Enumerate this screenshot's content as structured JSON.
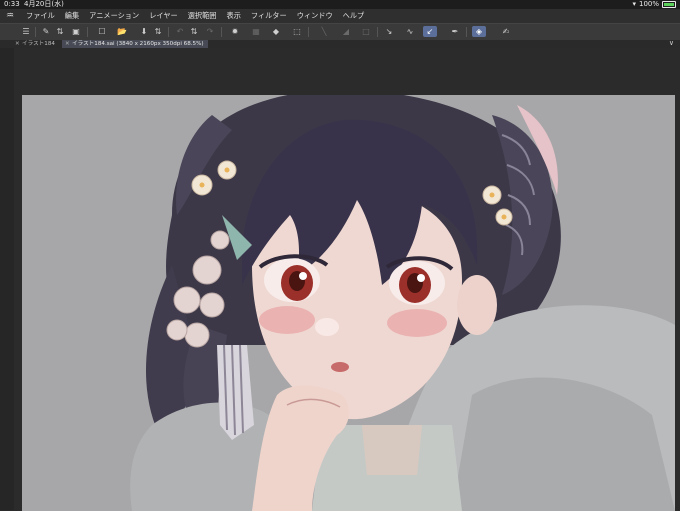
{
  "status": {
    "time": "0:33",
    "date": "4月20日(水)",
    "battery": "100%"
  },
  "menu": {
    "app_icon": "clip-studio-icon",
    "items": [
      "ファイル",
      "編集",
      "アニメーション",
      "レイヤー",
      "選択範囲",
      "表示",
      "フィルター",
      "ウィンドウ",
      "ヘルプ"
    ]
  },
  "toolbar": {
    "icons": [
      "menu-icon",
      "new-icon",
      "stepper-icon",
      "gallery-icon",
      "new-canvas-icon",
      "open-icon",
      "save-icon",
      "stepper-icon",
      "undo-icon",
      "stepper-icon",
      "redo-icon",
      "clear-icon",
      "transform-icon",
      "fill-icon",
      "select-icon",
      "ruler-icon",
      "gradient-icon",
      "snap-icon",
      "pen-icon",
      "brush-icon",
      "correction-pen-icon",
      "eyedropper-icon",
      "eraser-icon",
      "notes-icon"
    ],
    "active_tool": "correction-pen-icon"
  },
  "tabs": [
    {
      "label": "イラスト184",
      "active": false
    },
    {
      "label": "イラスト184.sai (3840 x 2160px 350dpi 68.5%)",
      "active": true
    }
  ],
  "canvas": {
    "background": "#a7a7a9",
    "artwork": "illustration of a girl with dark braided hair, flower hairpin, red eyes, hand on chin"
  }
}
